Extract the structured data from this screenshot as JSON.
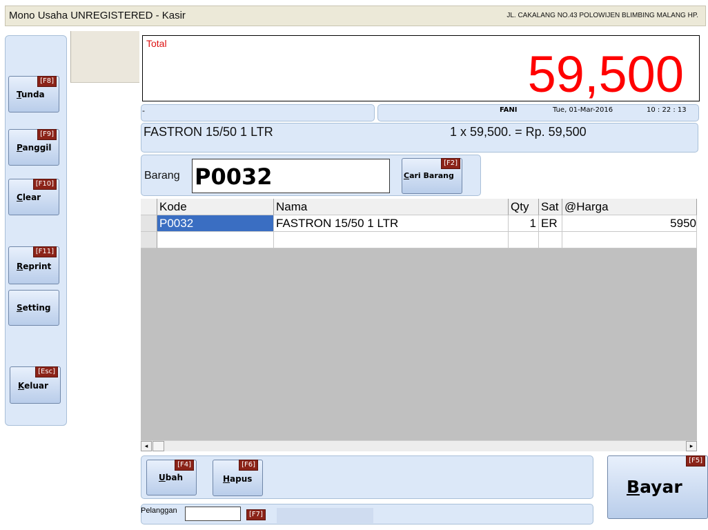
{
  "window": {
    "title": "Mono Usaha UNREGISTERED - Kasir",
    "address": "JL. CAKALANG NO.43 POLOWIJEN BLIMBING MALANG  HP."
  },
  "sidebar": {
    "buttons": [
      {
        "key": "[F8]",
        "ul": "T",
        "rest": "unda"
      },
      {
        "key": "[F9]",
        "ul": "P",
        "rest": "anggil"
      },
      {
        "key": "[F10]",
        "ul": "C",
        "rest": "lear"
      },
      {
        "key": "[F11]",
        "ul": "R",
        "rest": "eprint"
      },
      {
        "key": "",
        "ul": "S",
        "rest": "etting"
      },
      {
        "key": "[Esc]",
        "ul": "K",
        "rest": "eluar"
      }
    ]
  },
  "total": {
    "label": "Total",
    "value": "59,500"
  },
  "status": {
    "left": "-",
    "user": "FANI",
    "date": "Tue, 01-Mar-2016",
    "time": "10 : 22 : 13"
  },
  "last_item": {
    "name": "FASTRON 15/50 1 LTR",
    "calc": "1 x 59,500.  = Rp. 59,500"
  },
  "entry": {
    "label": "Barang",
    "value": "P0032",
    "search": {
      "key": "[F2]",
      "ul": "C",
      "rest": "ari Barang"
    }
  },
  "grid": {
    "columns": [
      "Kode",
      "Nama",
      "Qty",
      "Sat",
      "@Harga"
    ],
    "rows": [
      {
        "kode": "P0032",
        "nama": "FASTRON 15/50 1 LTR",
        "qty": "1",
        "sat": "ER",
        "harga": "5950"
      }
    ]
  },
  "scrollbar": {
    "left_arrow": "◂",
    "right_arrow": "▸"
  },
  "actions": {
    "ubah": {
      "key": "[F4]",
      "ul": "U",
      "rest": "bah"
    },
    "hapus": {
      "key": "[F6]",
      "ul": "H",
      "rest": "apus"
    },
    "bayar": {
      "key": "[F5]",
      "ul": "B",
      "rest": "ayar"
    }
  },
  "customer": {
    "label": "Pelanggan",
    "value": "",
    "key": "[F7]"
  }
}
